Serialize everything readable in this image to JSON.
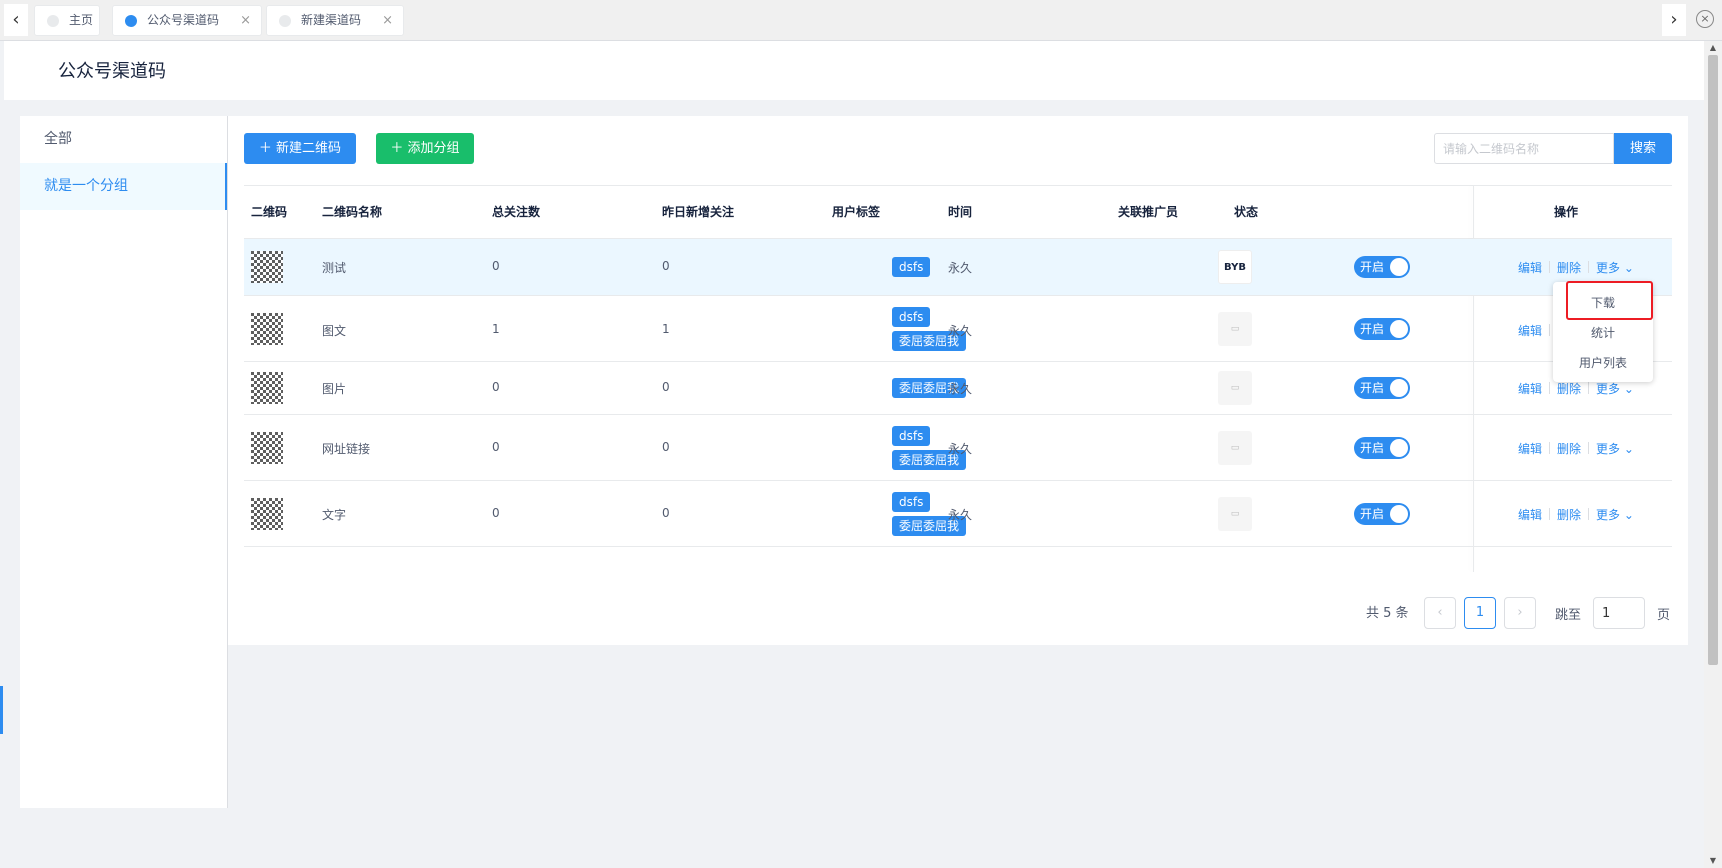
{
  "tabs": {
    "home": "主页",
    "qr": "公众号渠道码",
    "new": "新建渠道码",
    "close": "×"
  },
  "page_title": "公众号渠道码",
  "sidebar": {
    "items": [
      {
        "label": "全部"
      },
      {
        "label": "就是一个分组"
      }
    ]
  },
  "toolbar": {
    "new_qr_label": "＋ 新建二维码",
    "add_group_label": "＋ 添加分组",
    "search_placeholder": "请输入二维码名称",
    "search_label": "搜索"
  },
  "table": {
    "headers": {
      "qr": "二维码",
      "name": "二维码名称",
      "total": "总关注数",
      "yesterday": "昨日新增关注",
      "tags": "用户标签",
      "time": "时间",
      "promoter": "关联推广员",
      "status": "状态",
      "actions": "操作"
    },
    "rows": [
      {
        "name": "测试",
        "total": "0",
        "yesterday": "0",
        "tags": [
          "dsfs"
        ],
        "time": "永久",
        "promoter": "BYB",
        "status": "开启"
      },
      {
        "name": "图文",
        "total": "1",
        "yesterday": "1",
        "tags": [
          "dsfs",
          "委屈委屈我"
        ],
        "time": "永久",
        "promoter": "",
        "status": "开启"
      },
      {
        "name": "图片",
        "total": "0",
        "yesterday": "0",
        "tags": [
          "委屈委屈我"
        ],
        "time": "永久",
        "promoter": "",
        "status": "开启"
      },
      {
        "name": "网址链接",
        "total": "0",
        "yesterday": "0",
        "tags": [
          "dsfs",
          "委屈委屈我"
        ],
        "time": "永久",
        "promoter": "",
        "status": "开启"
      },
      {
        "name": "文字",
        "total": "0",
        "yesterday": "0",
        "tags": [
          "dsfs",
          "委屈委屈我"
        ],
        "time": "永久",
        "promoter": "",
        "status": "开启"
      }
    ],
    "actions": {
      "edit": "编辑",
      "delete": "删除",
      "more": "更多"
    }
  },
  "more_menu": {
    "items": [
      "下载",
      "统计",
      "用户列表"
    ],
    "highlighted": "下载"
  },
  "pagination": {
    "total": "共 5 条",
    "current": "1",
    "jump_label": "跳至",
    "jump_value": "1",
    "page_label": "页"
  },
  "colors": {
    "primary": "#2d8cf0",
    "success": "#19be6b",
    "highlight_border": "#ed1c24"
  }
}
